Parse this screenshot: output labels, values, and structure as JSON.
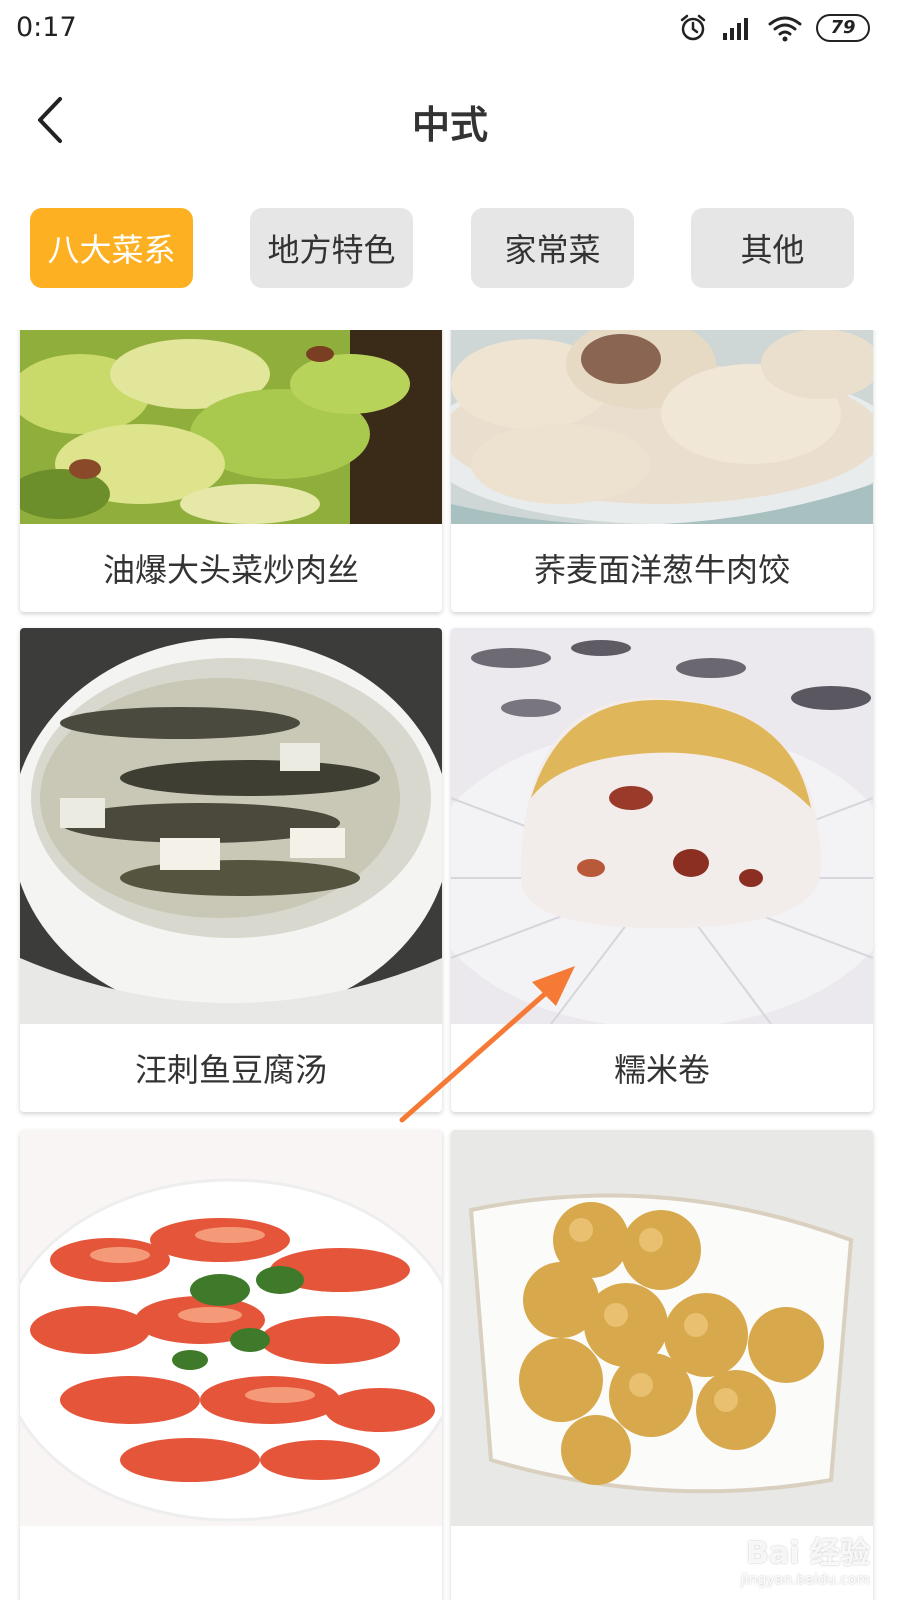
{
  "status_bar": {
    "time": "0:17",
    "battery": "79",
    "icons": [
      "alarm-icon",
      "signal-icon",
      "wifi-icon",
      "battery-icon"
    ]
  },
  "nav": {
    "back_icon": "chevron-left-icon",
    "title": "中式"
  },
  "tabs": [
    {
      "label": "八大菜系",
      "active": true
    },
    {
      "label": "地方特色",
      "active": false
    },
    {
      "label": "家常菜",
      "active": false
    },
    {
      "label": "其他",
      "active": false
    }
  ],
  "dishes": [
    {
      "name": "油爆大头菜炒肉丝",
      "image": "stir-fried-cabbage-photo"
    },
    {
      "name": "荞麦面洋葱牛肉饺",
      "image": "dumplings-photo"
    },
    {
      "name": "汪刺鱼豆腐汤",
      "image": "fish-tofu-soup-photo"
    },
    {
      "name": "糯米卷",
      "image": "glutinous-rice-roll-photo"
    },
    {
      "name": "",
      "image": "boiled-shrimp-photo"
    },
    {
      "name": "",
      "image": "fried-balls-photo"
    }
  ],
  "watermark": {
    "main": "Bai 经验",
    "sub": "jingyan.baidu.com"
  },
  "colors": {
    "accent": "#fdb022",
    "tab_inactive": "#e6e6e6",
    "annotation_arrow": "#f47a35"
  }
}
